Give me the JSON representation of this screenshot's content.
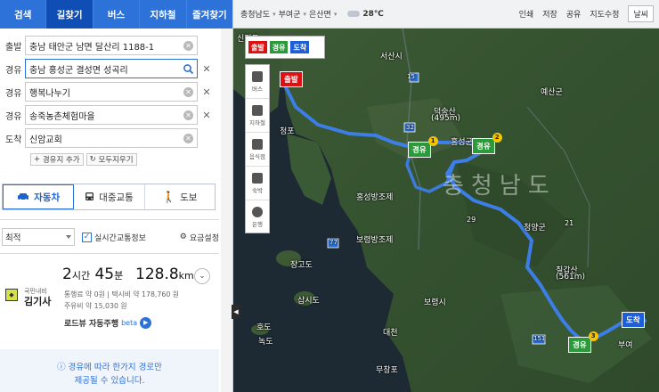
{
  "tabs": [
    "검색",
    "길찾기",
    "버스",
    "지하철",
    "즐겨찾기"
  ],
  "route": {
    "rows": [
      {
        "label": "출발",
        "value": "충남 태안군 남면 달산리 1188-1"
      },
      {
        "label": "경유",
        "value": "충남 홍성군 결성면 성곡리"
      },
      {
        "label": "경유",
        "value": "행복나누기"
      },
      {
        "label": "경유",
        "value": "송죽농촌체험마을"
      },
      {
        "label": "도착",
        "value": "신암교회"
      }
    ],
    "add_via": "경유지 추가",
    "clear_all": "모두지우기"
  },
  "modes": {
    "car": "자동차",
    "transit": "대중교통",
    "walk": "도보"
  },
  "options": {
    "route_pref": "최적",
    "realtime_traffic": "실시간교통정보",
    "fee_settings": "요금설정"
  },
  "result": {
    "navi_small": "국민내비",
    "navi_name": "김기사",
    "hours": "2",
    "hours_unit": "시간",
    "minutes": "45",
    "minutes_unit": "분",
    "distance": "128.8",
    "distance_unit": "km",
    "toll": "통행료 약 0원",
    "taxi": "택시비 약 178,760 원",
    "fuel": "주유비 약 15,030 원",
    "roadview": "로드뷰 자동주행",
    "beta": "beta"
  },
  "notice": [
    "경유에 따라 한가지 경로만",
    "제공될 수 있습니다."
  ],
  "map": {
    "breadcrumb": [
      "충청남도",
      "부여군",
      "은산면"
    ],
    "temperature": "28℃",
    "tools": [
      "인쇄",
      "저장",
      "공유",
      "지도수정"
    ],
    "weather_button": "날씨",
    "legend": {
      "start": "출발",
      "via": "경유",
      "end": "도착"
    },
    "side_tools": [
      "버스",
      "지하철",
      "음식점",
      "숙박",
      "은행"
    ],
    "places": [
      "신진도",
      "청포",
      "서산시",
      "홍성군",
      "예산군",
      "덕숭산",
      "(495m)",
      "홍성방조제",
      "보령방조제",
      "청양군",
      "칠갑산",
      "(561m)",
      "장고도",
      "삽시도",
      "호도",
      "녹도",
      "보령시",
      "대천",
      "무창포",
      "부여"
    ],
    "region": "충청남도",
    "markers": {
      "start": "출발",
      "via": "경유",
      "end": "도착",
      "via_numbers": [
        "1",
        "2",
        "3"
      ]
    },
    "roads": [
      "15",
      "32",
      "29",
      "77",
      "21",
      "151"
    ]
  },
  "colors": {
    "brand_blue": "#2c72d9",
    "route": "#3d7ff0",
    "start": "#d11111",
    "via": "#2a9a3a",
    "end": "#1e5fd8"
  }
}
